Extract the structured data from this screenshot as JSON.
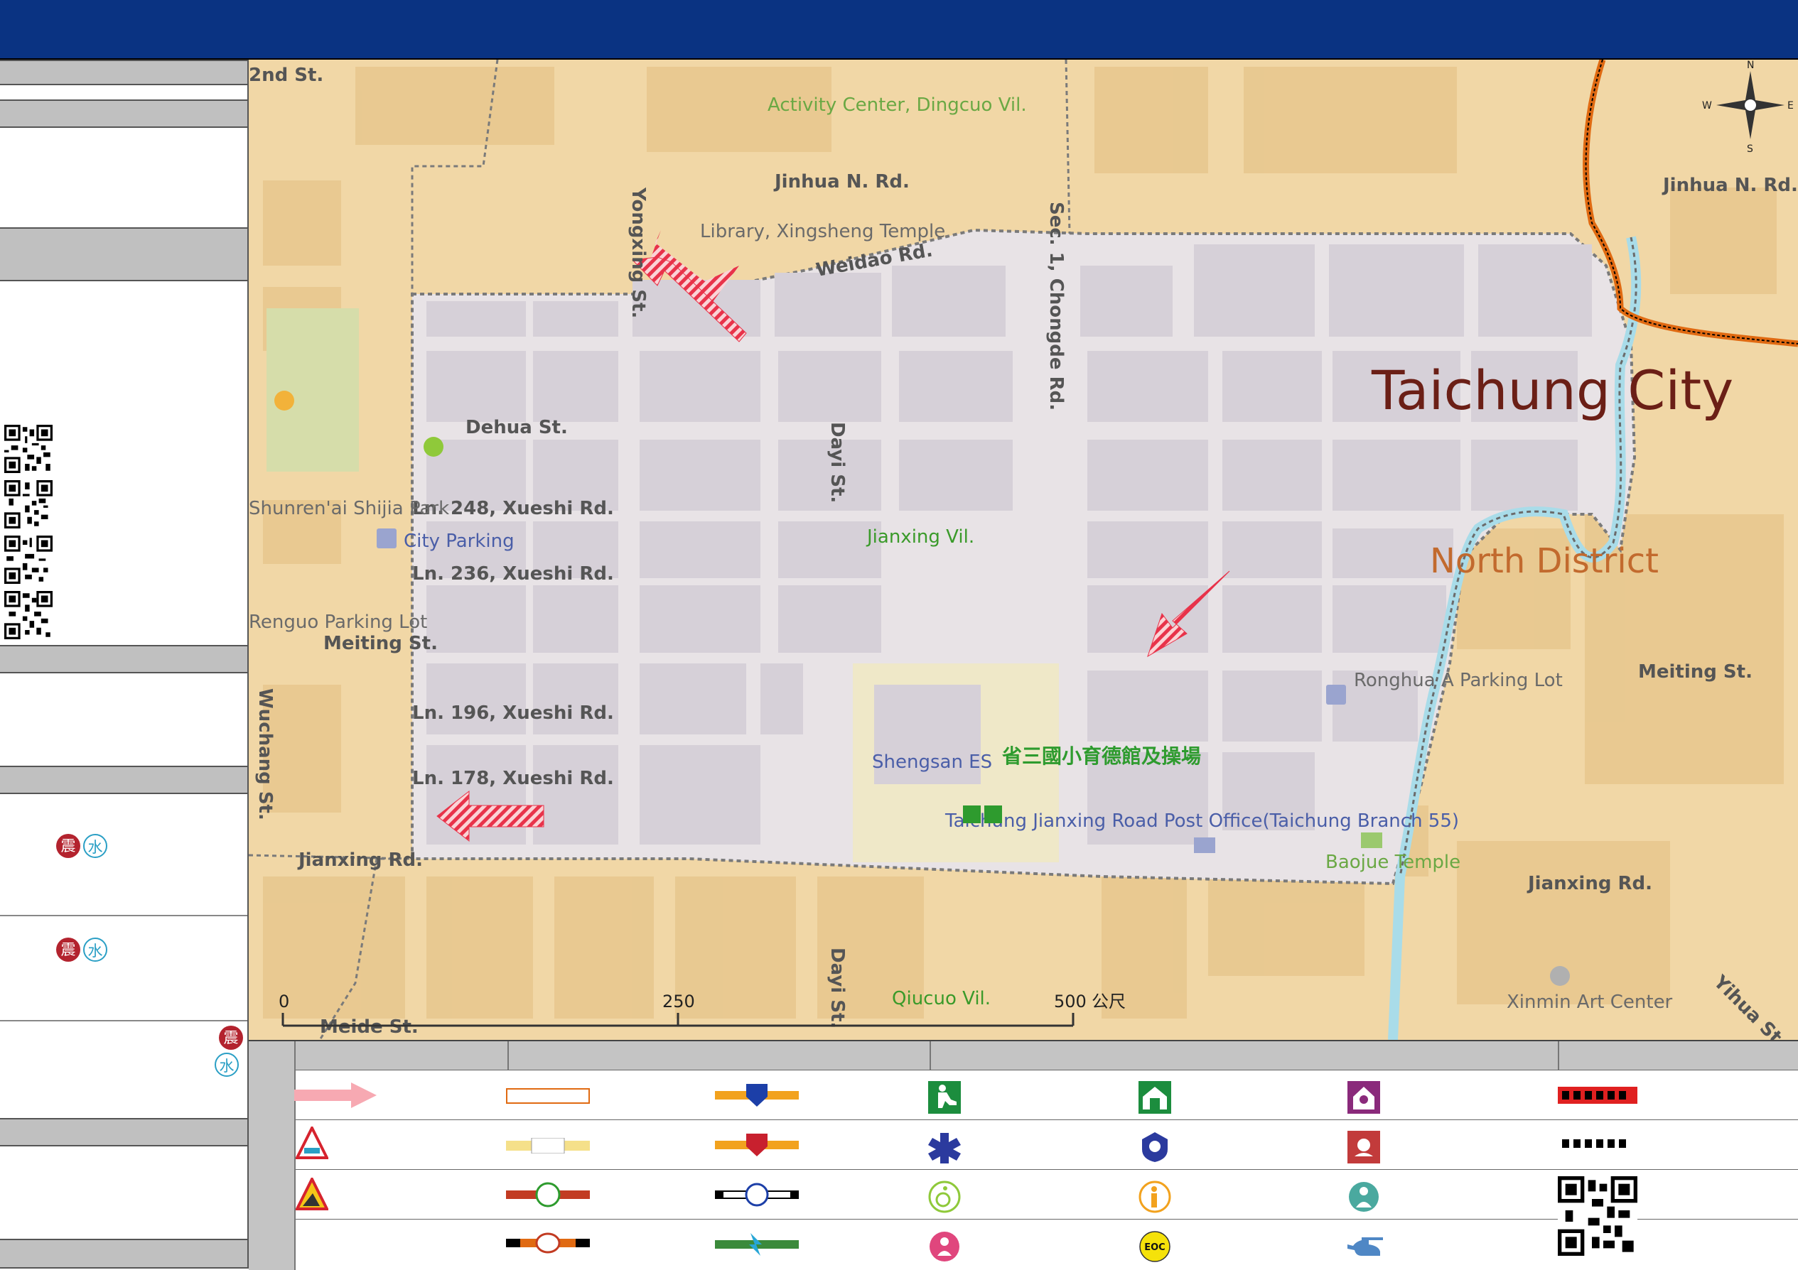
{
  "map": {
    "district_labels": [
      "Taichung City",
      "North District"
    ],
    "village_labels": [
      "Jianxing Vil.",
      "Qiucuo Vil.",
      "Activity Center, Dingcuo Vil."
    ],
    "roads": [
      "2nd St.",
      "Jinhua N. Rd.",
      "Jinhua N. Rd.",
      "Weidao Rd.",
      "Yongxing St.",
      "Sec. 1, Chongde Rd.",
      "Dehua St.",
      "Dayi St.",
      "Ln. 248, Xueshi Rd.",
      "Ln. 236, Xueshi Rd.",
      "Meiting St.",
      "Meiting St.",
      "Ln. 196, Xueshi Rd.",
      "Ln. 178, Xueshi Rd.",
      "Jianxing Rd.",
      "Jianxing Rd.",
      "Wuchang St.",
      "Meide St.",
      "Dayi St.",
      "Yihua St.",
      "Jinhua N. Rd."
    ],
    "places": {
      "library": "Library, Xingsheng Temple",
      "park": "Shunren'ai Shijia Park",
      "parking": "City Parking",
      "parking_lot": "Renguo Parking Lot",
      "ronghua": "Ronghua A Parking Lot",
      "school": "Shengsan ES",
      "shelter": "省三國小育德館及操場",
      "post": "Taichung Jianxing Road Post Office(Taichung Branch 55)",
      "baojue": "Baojue Temple",
      "xinmin": "Xinmin Art Center"
    },
    "compass": {
      "n": "N",
      "s": "S",
      "e": "E",
      "w": "W"
    },
    "scale": {
      "ticks": [
        "0",
        "250",
        "500"
      ],
      "unit": "公尺"
    }
  },
  "sidebar": {
    "hazard_earthquake": "震",
    "hazard_flood": "水"
  },
  "legend": {
    "eoc_label": "EOC"
  },
  "colors": {
    "header": "#0a3382",
    "map_base": "#f1d7a6",
    "village_area": "#e8e3e6",
    "district_text": "#6b1f16",
    "north_district_text": "#c26a2e",
    "green_label": "#3a9a2a",
    "evac_arrow": "#e8334a",
    "river": "#a9dce9",
    "boundary": "#e06a12"
  }
}
